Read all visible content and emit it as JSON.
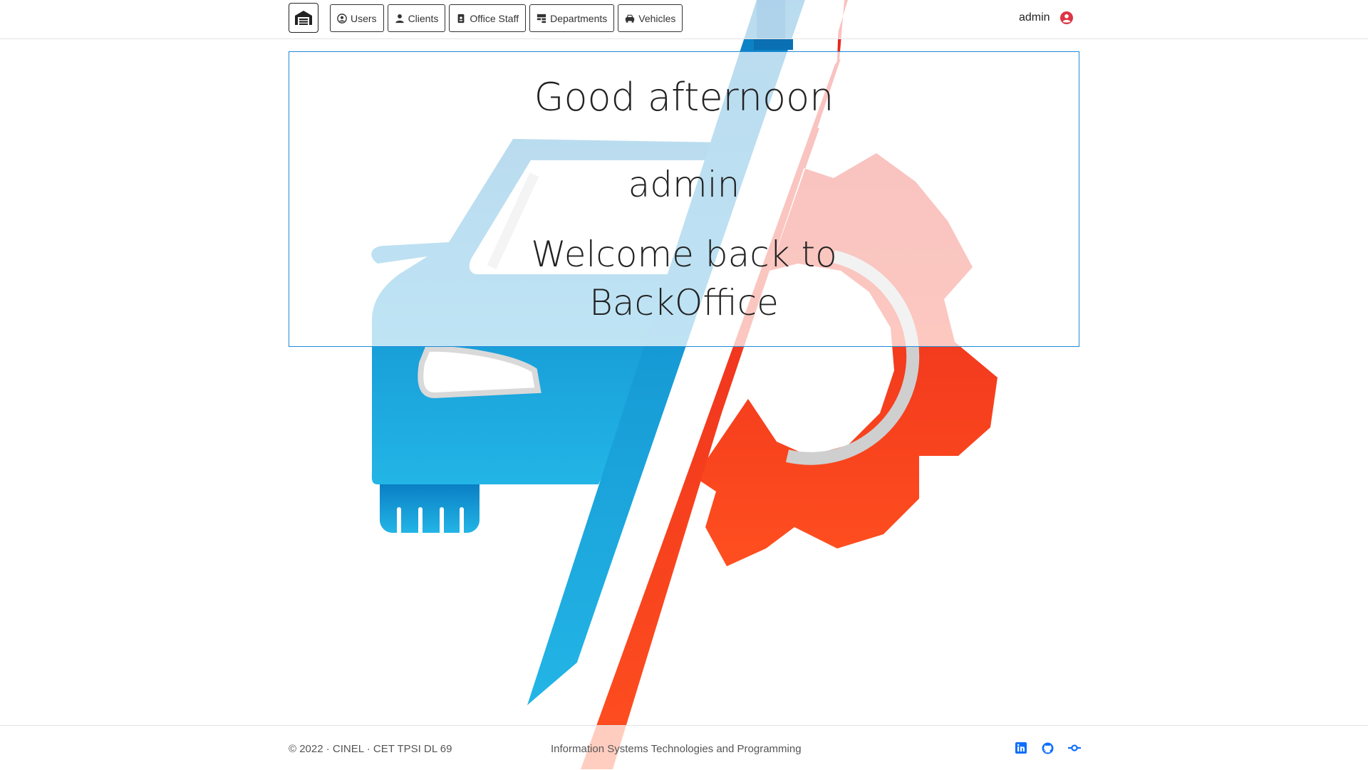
{
  "navbar": {
    "brand_icon": "warehouse-icon",
    "items": [
      {
        "label": "Users",
        "icon": "user-circle-icon"
      },
      {
        "label": "Clients",
        "icon": "person-icon"
      },
      {
        "label": "Office Staff",
        "icon": "id-badge-icon"
      },
      {
        "label": "Departments",
        "icon": "sitemap-icon"
      },
      {
        "label": "Vehicles",
        "icon": "car-icon"
      }
    ],
    "user_name": "admin",
    "user_icon": "user-circle-icon"
  },
  "welcome": {
    "greeting": "Good afternoon",
    "user": "admin",
    "message_line1": "Welcome back to",
    "message_line2": "BackOffice"
  },
  "footer": {
    "copyright": "© 2022 · CINEL · CET TPSI DL 69",
    "course": "Information Systems Technologies and Programming",
    "socials": [
      "linkedin-icon",
      "github-icon",
      "git-commit-icon"
    ]
  },
  "colors": {
    "accent_blue": "#1e8ad8",
    "accent_red": "#f03a2a",
    "user_icon_red": "#dc3545",
    "social_blue": "#0d6efd"
  }
}
